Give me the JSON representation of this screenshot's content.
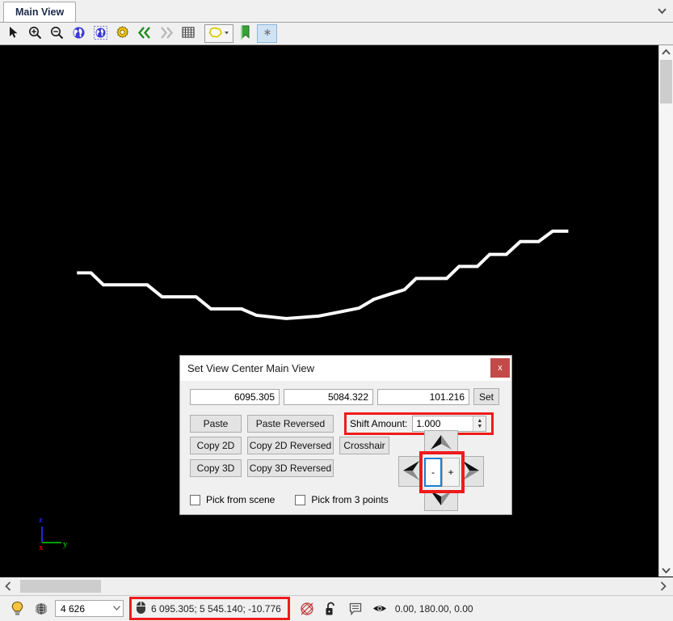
{
  "window": {
    "tab_label": "Main View",
    "tabstrip_chevron_icon": "chevron-down-icon"
  },
  "toolbar": {
    "items": [
      {
        "icon": "pointer-cursor-icon",
        "name": "select-tool"
      },
      {
        "icon": "zoom-in-icon",
        "name": "zoom-in-tool"
      },
      {
        "icon": "zoom-out-icon",
        "name": "zoom-out-tool"
      },
      {
        "icon": "globe-icon",
        "name": "globe-view-tool"
      },
      {
        "icon": "globe-selected-icon",
        "name": "globe-select-tool"
      },
      {
        "icon": "gear-icon",
        "name": "settings-tool"
      },
      {
        "icon": "double-chevron-left-icon",
        "name": "previous-view-tool"
      },
      {
        "icon": "double-chevron-right-icon",
        "name": "next-view-tool"
      },
      {
        "icon": "grid-icon",
        "name": "grid-tool"
      },
      {
        "icon": "lasso-polygon-dropdown-icon",
        "name": "selection-shape-tool"
      },
      {
        "icon": "green-bookmark-icon",
        "name": "bookmark-tool"
      },
      {
        "icon": "asterisk-icon",
        "name": "asterisk-tool"
      }
    ]
  },
  "viewport": {
    "background_color": "#000000",
    "axis_gizmo": {
      "z_label": "z",
      "y_label": "y",
      "x_label": "x",
      "z_color": "#2424d8",
      "y_color": "#00a000",
      "x_color": "#cc0000"
    },
    "polyline_color": "#ffffff",
    "polyline_points": "93,339 110,339 125,354 163,354 178,354 196,369 237,369 255,384 292,384 310,392 346,396 385,393 410,388 434,383 452,372 470,366 489,360 503,346 540,346 555,331 577,331 592,316 612,316 629,300 651,300 668,287 687,287"
  },
  "dialog": {
    "title": "Set View Center Main View",
    "close_label": "x",
    "coords": {
      "x_value": "6095.305",
      "y_value": "5084.322",
      "z_value": "101.216",
      "set_label": "Set"
    },
    "buttons": {
      "paste": "Paste",
      "paste_reversed": "Paste Reversed",
      "copy_2d": "Copy 2D",
      "copy_2d_reversed": "Copy 2D Reversed",
      "copy_3d": "Copy 3D",
      "copy_3d_reversed": "Copy 3D Reversed",
      "crosshair": "Crosshair"
    },
    "shift": {
      "label": "Shift Amount:",
      "value": "1.000",
      "highlight_color": "#ee1b1b",
      "spin_up_icon": "spin-up-icon",
      "spin_down_icon": "spin-down-icon"
    },
    "dpad": {
      "up_icon": "arrow-up-icon",
      "down_icon": "arrow-down-icon",
      "left_icon": "arrow-left-icon",
      "right_icon": "arrow-right-icon",
      "minus_label": "-",
      "plus_label": "+",
      "highlight_color": "#ee1b1b",
      "focus_color": "#1a7fd4"
    },
    "checkboxes": [
      {
        "label": "Pick from scene",
        "checked": false
      },
      {
        "label": "Pick from 3 points",
        "checked": false
      }
    ]
  },
  "hscrollbar": {
    "left_icon": "chevron-left-icon",
    "right_icon": "chevron-right-icon"
  },
  "vscrollbar": {
    "up_icon": "chevron-up-icon",
    "down_icon": "chevron-down-icon"
  },
  "statusbar": {
    "lightbulb_icon": "lightbulb-icon",
    "globe_wire_icon": "globe-wireframe-icon",
    "point_count": "4 626",
    "combo_caret_icon": "chevron-down-icon",
    "mouse_icon": "mouse-icon",
    "coordinates": "6 095.305; 5 545.140; -10.776",
    "coordinates_highlight_color": "#ee1b1b",
    "crosshair_icon": "crosshair-red-icon",
    "lock_icon": "lock-open-icon",
    "note_icon": "note-icon",
    "eye_icon": "eye-icon",
    "angles": "0.00, 180.00, 0.00"
  }
}
